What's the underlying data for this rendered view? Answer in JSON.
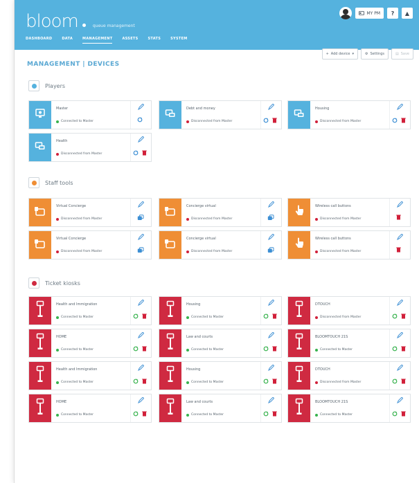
{
  "app": {
    "logo_word": "bloom",
    "logo_sub": "queue management",
    "user_button": "MY PM",
    "help_button": "?",
    "notify_button": "▲"
  },
  "nav": [
    {
      "label": "DASHBOARD",
      "active": false
    },
    {
      "label": "DATA",
      "active": false
    },
    {
      "label": "MANAGEMENT",
      "active": true
    },
    {
      "label": "ASSETS",
      "active": false
    },
    {
      "label": "STATS",
      "active": false
    },
    {
      "label": "SYSTEM",
      "active": false
    }
  ],
  "page": {
    "title": "MANAGEMENT | DEVICES"
  },
  "toolbar": {
    "add_device": "Add device",
    "settings": "Settings",
    "save": "Save"
  },
  "colors": {
    "players": "#55b2de",
    "staff": "#ef8e35",
    "tickets": "#cf2a41",
    "connected": "#37b24d",
    "disconnected": "#d1203a",
    "action_blue": "#3d8fd4",
    "action_green": "#37b24d",
    "action_red": "#d1203a"
  },
  "sections": [
    {
      "id": "players",
      "label": "Players",
      "badge_color": "#55b2de"
    },
    {
      "id": "staff",
      "label": "Staff tools",
      "badge_color": "#ef8e35"
    },
    {
      "id": "tickets",
      "label": "Ticket kiosks",
      "badge_color": "#cf2a41"
    }
  ],
  "devices": [
    {
      "section": "players",
      "name": "Master",
      "status": "Connected to Master",
      "connected": true,
      "icon": "monitor-icon"
    },
    {
      "section": "players",
      "name": "Debt and money",
      "status": "Disconnected from Master",
      "connected": false,
      "icon": "player-icon"
    },
    {
      "section": "players",
      "name": "Housing",
      "status": "Disconnected from Master",
      "connected": false,
      "icon": "player-icon"
    },
    {
      "section": "players",
      "name": "Health",
      "status": "Disconnected from Master",
      "connected": false,
      "icon": "player-icon"
    },
    {
      "section": "staff",
      "name": "Virtual Concierge",
      "status": "Disconnected from Master",
      "connected": false,
      "icon": "staff-icon"
    },
    {
      "section": "staff",
      "name": "Concierge virtual",
      "status": "Disconnected from Master",
      "connected": false,
      "icon": "staff-icon"
    },
    {
      "section": "staff",
      "name": "Wireless call buttons",
      "status": "Disconnected from Master",
      "connected": false,
      "icon": "tap-icon"
    },
    {
      "section": "staff",
      "name": "Virtual Concierge",
      "status": "Disconnected from Master",
      "connected": false,
      "icon": "staff-icon"
    },
    {
      "section": "staff",
      "name": "Concierge virtual",
      "status": "Disconnected from Master",
      "connected": false,
      "icon": "staff-icon"
    },
    {
      "section": "staff",
      "name": "Wireless call buttons",
      "status": "Disconnected from Master",
      "connected": false,
      "icon": "tap-icon"
    },
    {
      "section": "tickets",
      "name": "Health and Immigration",
      "status": "Connected to Master",
      "connected": true,
      "icon": "kiosk-icon"
    },
    {
      "section": "tickets",
      "name": "Housing",
      "status": "Connected to Master",
      "connected": true,
      "icon": "kiosk-icon"
    },
    {
      "section": "tickets",
      "name": "DTOUCH",
      "status": "Disconnected from Master",
      "connected": false,
      "icon": "kiosk-icon"
    },
    {
      "section": "tickets",
      "name": "HOME",
      "status": "Connected to Master",
      "connected": true,
      "icon": "kiosk-icon"
    },
    {
      "section": "tickets",
      "name": "Law and courts",
      "status": "Connected to Master",
      "connected": true,
      "icon": "kiosk-icon"
    },
    {
      "section": "tickets",
      "name": "BLOOMTOUCH 21S",
      "status": "Connected to Master",
      "connected": true,
      "icon": "kiosk-icon"
    },
    {
      "section": "tickets",
      "name": "Health and Immigration",
      "status": "Connected to Master",
      "connected": true,
      "icon": "kiosk-icon"
    },
    {
      "section": "tickets",
      "name": "Housing",
      "status": "Connected to Master",
      "connected": true,
      "icon": "kiosk-icon"
    },
    {
      "section": "tickets",
      "name": "DTOUCH",
      "status": "Disconnected from Master",
      "connected": false,
      "icon": "kiosk-icon"
    },
    {
      "section": "tickets",
      "name": "HOME",
      "status": "Connected to Master",
      "connected": true,
      "icon": "kiosk-icon"
    },
    {
      "section": "tickets",
      "name": "Law and courts",
      "status": "Connected to Master",
      "connected": true,
      "icon": "kiosk-icon"
    },
    {
      "section": "tickets",
      "name": "BLOOMTOUCH 21S",
      "status": "Connected to Master",
      "connected": true,
      "icon": "kiosk-icon"
    }
  ]
}
